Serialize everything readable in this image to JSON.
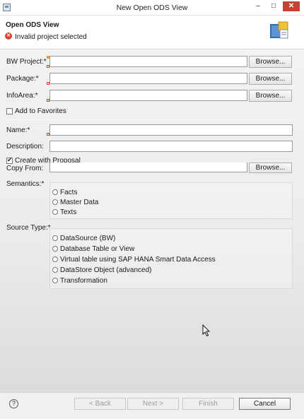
{
  "window": {
    "title": "New Open ODS View"
  },
  "header": {
    "title": "Open ODS View",
    "message": "Invalid project selected"
  },
  "form": {
    "bw_project_label": "BW Project:*",
    "package_label": "Package:*",
    "infoarea_label": "InfoArea:*",
    "browse_label": "Browse...",
    "add_to_favorites": "Add to Favorites",
    "name_label": "Name:*",
    "description_label": "Description:",
    "create_with_proposal": "Create with Proposal",
    "copy_from_label": "Copy From:",
    "semantics_label": "Semantics:*",
    "semantics_options": [
      "Facts",
      "Master Data",
      "Texts"
    ],
    "source_type_label": "Source Type:*",
    "source_type_options": [
      "DataSource (BW)",
      "Database Table or View",
      "Virtual table using SAP HANA Smart Data Access",
      "DataStore Object (advanced)",
      "Transformation"
    ]
  },
  "footer": {
    "help": "?",
    "back": "< Back",
    "next": "Next >",
    "finish": "Finish",
    "cancel": "Cancel"
  }
}
